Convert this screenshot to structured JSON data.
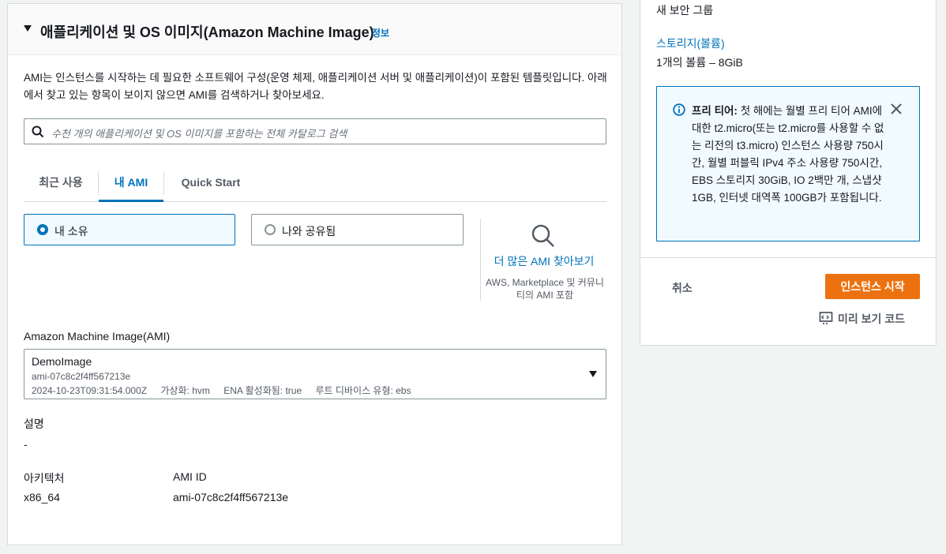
{
  "ami_panel": {
    "title": "애플리케이션 및 OS 이미지(Amazon Machine Image)",
    "info_link": "정보",
    "description": "AMI는 인스턴스를 시작하는 데 필요한 소프트웨어 구성(운영 체제, 애플리케이션 서버 및 애플리케이션)이 포함된 템플릿입니다. 아래에서 찾고 있는 항목이 보이지 않으면 AMI를 검색하거나 찾아보세요.",
    "search_placeholder": "수천 개의 애플리케이션 및 OS 이미지를 포함하는 전체 카탈로그 검색",
    "tabs": [
      {
        "label": "최근 사용",
        "active": false
      },
      {
        "label": "내 AMI",
        "active": true
      },
      {
        "label": "Quick Start",
        "active": false
      }
    ],
    "ownership_options": [
      {
        "label": "내 소유",
        "selected": true
      },
      {
        "label": "나와 공유됨",
        "selected": false
      }
    ],
    "browse": {
      "link": "더 많은 AMI 찾아보기",
      "sub": "AWS, Marketplace 및 커뮤니티의 AMI 포함"
    },
    "ami_field": {
      "label": "Amazon Machine Image(AMI)",
      "name": "DemoImage",
      "id": "ami-07c8c2f4ff567213e",
      "created": "2024-10-23T09:31:54.000Z",
      "virtualization": "가상화: hvm",
      "ena": "ENA 활성화됨: true",
      "root_device": "루트 디바이스 유형: ebs"
    },
    "description_field": {
      "label": "설명",
      "value": "-"
    },
    "architecture_field": {
      "label": "아키텍처",
      "value": "x86_64"
    },
    "ami_id_field": {
      "label": "AMI ID",
      "value": "ami-07c8c2f4ff567213e"
    }
  },
  "summary_panel": {
    "security_group": "새 보안 그룹",
    "storage_link": "스토리지(볼륨)",
    "storage_value": "1개의 볼륨 – 8GiB",
    "free_tier": {
      "title": "프리 티어:",
      "body": " 첫 해에는 월별 프리 티어 AMI에 대한 t2.micro(또는 t2.micro를 사용할 수 없는 리전의 t3.micro) 인스턴스 사용량 750시간, 월별 퍼블릭 IPv4 주소 사용량 750시간, EBS 스토리지 30GiB, IO 2백만 개, 스냅샷 1GB, 인터넷 대역폭 100GB가 포함됩니다."
    },
    "cancel": "취소",
    "launch": "인스턴스 시작",
    "preview_code": "미리 보기 코드"
  },
  "colors": {
    "link_blue": "#0073bb",
    "launch_orange": "#ec7211",
    "border_gray": "#879596"
  }
}
